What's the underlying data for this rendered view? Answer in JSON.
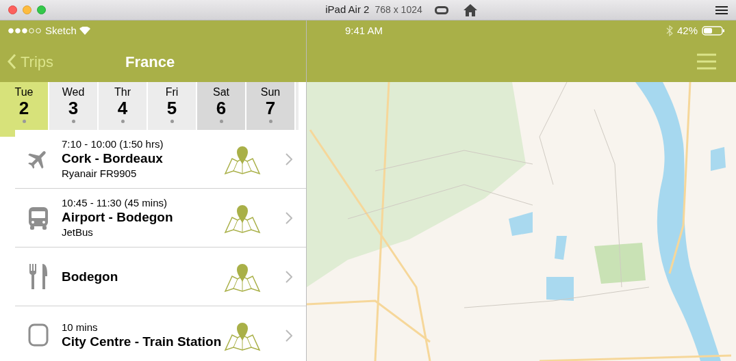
{
  "window": {
    "title": "iPad Air 2",
    "size": "768 x 1024"
  },
  "status_bar": {
    "carrier": "Sketch",
    "time": "9:41 AM",
    "battery": "42%"
  },
  "nav": {
    "back": "Trips",
    "title": "France"
  },
  "days": [
    {
      "day": "Tue",
      "date": "2",
      "selected": true,
      "kind": "weekday"
    },
    {
      "day": "Wed",
      "date": "3",
      "selected": false,
      "kind": "weekday"
    },
    {
      "day": "Thr",
      "date": "4",
      "selected": false,
      "kind": "weekday"
    },
    {
      "day": "Fri",
      "date": "5",
      "selected": false,
      "kind": "weekday"
    },
    {
      "day": "Sat",
      "date": "6",
      "selected": false,
      "kind": "weekend"
    },
    {
      "day": "Sun",
      "date": "7",
      "selected": false,
      "kind": "weekend"
    }
  ],
  "items": [
    {
      "kind": "flight",
      "time": "7:10 - 10:00 (1:50 hrs)",
      "title": "Cork - Bordeaux",
      "subtitle": "Ryanair FR9905"
    },
    {
      "kind": "bus",
      "time": "10:45 - 11:30 (45 mins)",
      "title": "Airport - Bodegon",
      "subtitle": "JetBus"
    },
    {
      "kind": "restaurant",
      "title": "Bodegon"
    },
    {
      "kind": "train",
      "time": "10 mins",
      "title": "City Centre - Train Station"
    }
  ]
}
